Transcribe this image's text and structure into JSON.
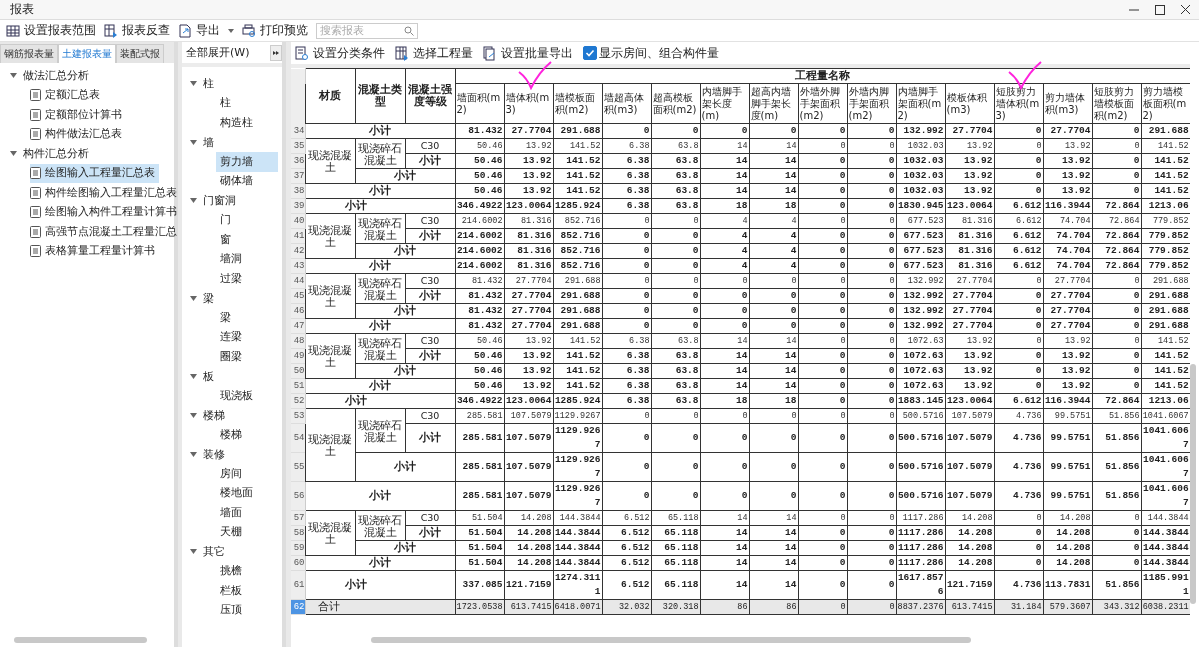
{
  "window": {
    "title": "报表"
  },
  "toolbar": [
    {
      "label": "设置报表范围",
      "kind": "range",
      "has_menu": false
    },
    {
      "label": "报表反查",
      "kind": "lookup",
      "has_menu": false
    },
    {
      "label": "导出",
      "kind": "export",
      "has_menu": true
    },
    {
      "label": "打印预览",
      "kind": "print",
      "has_menu": false
    }
  ],
  "search": {
    "placeholder": "搜索报表"
  },
  "report_tabs": [
    {
      "label": "钢筋报表量",
      "selected": false
    },
    {
      "label": "土建报表量",
      "selected": true
    },
    {
      "label": "装配式报",
      "selected": false
    }
  ],
  "report_tree": [
    {
      "label": "做法汇总分析",
      "expanded": true,
      "children": [
        {
          "label": "定额汇总表",
          "selected": false
        },
        {
          "label": "定额部位计算书",
          "selected": false
        },
        {
          "label": "构件做法汇总表",
          "selected": false
        }
      ]
    },
    {
      "label": "构件汇总分析",
      "expanded": true,
      "children": [
        {
          "label": "绘图输入工程量汇总表",
          "selected": true
        },
        {
          "label": "构件绘图输入工程量汇总表",
          "selected": false
        },
        {
          "label": "绘图输入构件工程量计算书",
          "selected": false
        },
        {
          "label": "高强节点混凝土工程量汇总",
          "selected": false
        },
        {
          "label": "表格算量工程量计算书",
          "selected": false
        }
      ]
    }
  ],
  "category_filter": {
    "value": "全部展开(W)"
  },
  "category_tree": [
    {
      "label": "柱",
      "expanded": true,
      "children": [
        {
          "label": "柱",
          "selected": false
        },
        {
          "label": "构造柱",
          "selected": false
        }
      ]
    },
    {
      "label": "墙",
      "expanded": true,
      "children": [
        {
          "label": "剪力墙",
          "selected": true
        },
        {
          "label": "砌体墙",
          "selected": false
        }
      ]
    },
    {
      "label": "门窗洞",
      "expanded": true,
      "children": [
        {
          "label": "门",
          "selected": false
        },
        {
          "label": "窗",
          "selected": false
        },
        {
          "label": "墙洞",
          "selected": false
        },
        {
          "label": "过梁",
          "selected": false
        }
      ]
    },
    {
      "label": "梁",
      "expanded": true,
      "children": [
        {
          "label": "梁",
          "selected": false
        },
        {
          "label": "连梁",
          "selected": false
        },
        {
          "label": "圈梁",
          "selected": false
        }
      ]
    },
    {
      "label": "板",
      "expanded": true,
      "children": [
        {
          "label": "现浇板",
          "selected": false
        }
      ]
    },
    {
      "label": "楼梯",
      "expanded": true,
      "children": [
        {
          "label": "楼梯",
          "selected": false
        }
      ]
    },
    {
      "label": "装修",
      "expanded": true,
      "children": [
        {
          "label": "房间",
          "selected": false
        },
        {
          "label": "楼地面",
          "selected": false
        },
        {
          "label": "墙面",
          "selected": false
        },
        {
          "label": "天棚",
          "selected": false
        }
      ]
    },
    {
      "label": "其它",
      "expanded": true,
      "children": [
        {
          "label": "挑檐",
          "selected": false
        },
        {
          "label": "栏板",
          "selected": false
        },
        {
          "label": "压顶",
          "selected": false
        }
      ]
    }
  ],
  "table_toolbar": {
    "buttons": [
      {
        "label": "设置分类条件",
        "kind": "classify"
      },
      {
        "label": "选择工程量",
        "kind": "select"
      },
      {
        "label": "设置批量导出",
        "kind": "batch"
      }
    ],
    "checkbox": {
      "label": "显示房间、组合构件量",
      "checked": true
    }
  },
  "table": {
    "fixed_columns": [
      "材质",
      "混凝土类型",
      "混凝土强度等级"
    ],
    "group_heading": "工程量名称",
    "columns": [
      {
        "label": "墙面积(m2)",
        "annotated": false
      },
      {
        "label": "墙体积(m3)",
        "annotated": true
      },
      {
        "label": "墙模板面积(m2)",
        "annotated": false
      },
      {
        "label": "墙超高体积(m3)",
        "annotated": false
      },
      {
        "label": "超高模板面积(m2)",
        "annotated": false
      },
      {
        "label": "内墙脚手架长度(m)",
        "annotated": false
      },
      {
        "label": "超高内墙脚手架长度(m)",
        "annotated": false
      },
      {
        "label": "外墙外脚手架面积(m2)",
        "annotated": false
      },
      {
        "label": "外墙内脚手架面积(m2)",
        "annotated": false
      },
      {
        "label": "内墙脚手架面积(m2)",
        "annotated": false
      },
      {
        "label": "模板体积(m3)",
        "annotated": false
      },
      {
        "label": "短肢剪力墙体积(m3)",
        "annotated": true
      },
      {
        "label": "剪力墙体积(m3)",
        "annotated": false
      },
      {
        "label": "短肢剪力墙模板面积(m2)",
        "annotated": false
      },
      {
        "label": "剪力墙模板面积(m2)",
        "annotated": false
      }
    ],
    "rows": [
      {
        "no": "34",
        "kind": "sub_material",
        "label": "小计",
        "selected": false,
        "values": [
          "81.432",
          "27.7704",
          "291.688",
          "0",
          "0",
          "0",
          "0",
          "0",
          "0",
          "132.992",
          "27.7704",
          "0",
          "27.7704",
          "0",
          "291.688"
        ]
      },
      {
        "no": "35",
        "kind": "detail",
        "material": "现浇混凝土",
        "type": "现浇碎石混凝土",
        "grade": "C30",
        "selected": false,
        "values": [
          "50.46",
          "13.92",
          "141.52",
          "6.38",
          "63.8",
          "14",
          "14",
          "0",
          "0",
          "1032.03",
          "13.92",
          "0",
          "13.92",
          "0",
          "141.52"
        ]
      },
      {
        "no": "36",
        "kind": "sub_grade",
        "label": "小计",
        "selected": false,
        "values": [
          "50.46",
          "13.92",
          "141.52",
          "6.38",
          "63.8",
          "14",
          "14",
          "0",
          "0",
          "1032.03",
          "13.92",
          "0",
          "13.92",
          "0",
          "141.52"
        ]
      },
      {
        "no": "37",
        "kind": "sub_type",
        "label": "小计",
        "selected": false,
        "values": [
          "50.46",
          "13.92",
          "141.52",
          "6.38",
          "63.8",
          "14",
          "14",
          "0",
          "0",
          "1032.03",
          "13.92",
          "0",
          "13.92",
          "0",
          "141.52"
        ]
      },
      {
        "no": "38",
        "kind": "sub_material",
        "label": "小计",
        "selected": false,
        "values": [
          "50.46",
          "13.92",
          "141.52",
          "6.38",
          "63.8",
          "14",
          "14",
          "0",
          "0",
          "1032.03",
          "13.92",
          "0",
          "13.92",
          "0",
          "141.52"
        ]
      },
      {
        "no": "39",
        "kind": "sub_total",
        "label": "小计",
        "selected": false,
        "values": [
          "346.4922",
          "123.0064",
          "1285.924",
          "6.38",
          "63.8",
          "18",
          "18",
          "0",
          "0",
          "1830.945",
          "123.0064",
          "6.612",
          "116.3944",
          "72.864",
          "1213.06"
        ]
      },
      {
        "no": "40",
        "kind": "detail",
        "material": "现浇混凝土",
        "type": "现浇碎石混凝土",
        "grade": "C30",
        "selected": false,
        "values": [
          "214.6002",
          "81.316",
          "852.716",
          "0",
          "0",
          "4",
          "4",
          "0",
          "0",
          "677.523",
          "81.316",
          "6.612",
          "74.704",
          "72.864",
          "779.852"
        ]
      },
      {
        "no": "41",
        "kind": "sub_grade",
        "label": "小计",
        "selected": false,
        "values": [
          "214.6002",
          "81.316",
          "852.716",
          "0",
          "0",
          "4",
          "4",
          "0",
          "0",
          "677.523",
          "81.316",
          "6.612",
          "74.704",
          "72.864",
          "779.852"
        ]
      },
      {
        "no": "42",
        "kind": "sub_type",
        "label": "小计",
        "selected": false,
        "values": [
          "214.6002",
          "81.316",
          "852.716",
          "0",
          "0",
          "4",
          "4",
          "0",
          "0",
          "677.523",
          "81.316",
          "6.612",
          "74.704",
          "72.864",
          "779.852"
        ]
      },
      {
        "no": "43",
        "kind": "sub_material",
        "label": "小计",
        "selected": false,
        "values": [
          "214.6002",
          "81.316",
          "852.716",
          "0",
          "0",
          "4",
          "4",
          "0",
          "0",
          "677.523",
          "81.316",
          "6.612",
          "74.704",
          "72.864",
          "779.852"
        ]
      },
      {
        "no": "44",
        "kind": "detail",
        "material": "现浇混凝土",
        "type": "现浇碎石混凝土",
        "grade": "C30",
        "selected": false,
        "values": [
          "81.432",
          "27.7704",
          "291.688",
          "0",
          "0",
          "0",
          "0",
          "0",
          "0",
          "132.992",
          "27.7704",
          "0",
          "27.7704",
          "0",
          "291.688"
        ]
      },
      {
        "no": "45",
        "kind": "sub_grade",
        "label": "小计",
        "selected": false,
        "values": [
          "81.432",
          "27.7704",
          "291.688",
          "0",
          "0",
          "0",
          "0",
          "0",
          "0",
          "132.992",
          "27.7704",
          "0",
          "27.7704",
          "0",
          "291.688"
        ]
      },
      {
        "no": "46",
        "kind": "sub_type",
        "label": "小计",
        "selected": false,
        "values": [
          "81.432",
          "27.7704",
          "291.688",
          "0",
          "0",
          "0",
          "0",
          "0",
          "0",
          "132.992",
          "27.7704",
          "0",
          "27.7704",
          "0",
          "291.688"
        ]
      },
      {
        "no": "47",
        "kind": "sub_material",
        "label": "小计",
        "selected": false,
        "values": [
          "81.432",
          "27.7704",
          "291.688",
          "0",
          "0",
          "0",
          "0",
          "0",
          "0",
          "132.992",
          "27.7704",
          "0",
          "27.7704",
          "0",
          "291.688"
        ]
      },
      {
        "no": "48",
        "kind": "detail",
        "material": "现浇混凝土",
        "type": "现浇碎石混凝土",
        "grade": "C30",
        "selected": false,
        "values": [
          "50.46",
          "13.92",
          "141.52",
          "6.38",
          "63.8",
          "14",
          "14",
          "0",
          "0",
          "1072.63",
          "13.92",
          "0",
          "13.92",
          "0",
          "141.52"
        ]
      },
      {
        "no": "49",
        "kind": "sub_grade",
        "label": "小计",
        "selected": false,
        "values": [
          "50.46",
          "13.92",
          "141.52",
          "6.38",
          "63.8",
          "14",
          "14",
          "0",
          "0",
          "1072.63",
          "13.92",
          "0",
          "13.92",
          "0",
          "141.52"
        ]
      },
      {
        "no": "50",
        "kind": "sub_type",
        "label": "小计",
        "selected": false,
        "values": [
          "50.46",
          "13.92",
          "141.52",
          "6.38",
          "63.8",
          "14",
          "14",
          "0",
          "0",
          "1072.63",
          "13.92",
          "0",
          "13.92",
          "0",
          "141.52"
        ]
      },
      {
        "no": "51",
        "kind": "sub_material",
        "label": "小计",
        "selected": false,
        "values": [
          "50.46",
          "13.92",
          "141.52",
          "6.38",
          "63.8",
          "14",
          "14",
          "0",
          "0",
          "1072.63",
          "13.92",
          "0",
          "13.92",
          "0",
          "141.52"
        ]
      },
      {
        "no": "52",
        "kind": "sub_total",
        "label": "小计",
        "selected": false,
        "values": [
          "346.4922",
          "123.0064",
          "1285.924",
          "6.38",
          "63.8",
          "18",
          "18",
          "0",
          "0",
          "1883.145",
          "123.0064",
          "6.612",
          "116.3944",
          "72.864",
          "1213.06"
        ]
      },
      {
        "no": "53",
        "kind": "detail",
        "material": "现浇混凝土",
        "type": "现浇碎石混凝土",
        "grade": "C30",
        "selected": false,
        "values": [
          "285.581",
          "107.5079",
          "1129.9267",
          "0",
          "0",
          "0",
          "0",
          "0",
          "0",
          "500.5716",
          "107.5079",
          "4.736",
          "99.5751",
          "51.856",
          "1041.6067"
        ]
      },
      {
        "no": "54",
        "kind": "sub_grade",
        "label": "小计",
        "selected": false,
        "values": [
          "285.581",
          "107.5079",
          "1129.9267",
          "0",
          "0",
          "0",
          "0",
          "0",
          "0",
          "500.5716",
          "107.5079",
          "4.736",
          "99.5751",
          "51.856",
          "1041.6067"
        ]
      },
      {
        "no": "55",
        "kind": "sub_type",
        "label": "小计",
        "selected": false,
        "values": [
          "285.581",
          "107.5079",
          "1129.9267",
          "0",
          "0",
          "0",
          "0",
          "0",
          "0",
          "500.5716",
          "107.5079",
          "4.736",
          "99.5751",
          "51.856",
          "1041.6067"
        ]
      },
      {
        "no": "56",
        "kind": "sub_material",
        "label": "小计",
        "selected": false,
        "values": [
          "285.581",
          "107.5079",
          "1129.9267",
          "0",
          "0",
          "0",
          "0",
          "0",
          "0",
          "500.5716",
          "107.5079",
          "4.736",
          "99.5751",
          "51.856",
          "1041.6067"
        ]
      },
      {
        "no": "57",
        "kind": "detail",
        "material": "现浇混凝土",
        "type": "现浇碎石混凝土",
        "grade": "C30",
        "selected": false,
        "values": [
          "51.504",
          "14.208",
          "144.3844",
          "6.512",
          "65.118",
          "14",
          "14",
          "0",
          "0",
          "1117.286",
          "14.208",
          "0",
          "14.208",
          "0",
          "144.3844"
        ]
      },
      {
        "no": "58",
        "kind": "sub_grade",
        "label": "小计",
        "selected": false,
        "values": [
          "51.504",
          "14.208",
          "144.3844",
          "6.512",
          "65.118",
          "14",
          "14",
          "0",
          "0",
          "1117.286",
          "14.208",
          "0",
          "14.208",
          "0",
          "144.3844"
        ]
      },
      {
        "no": "59",
        "kind": "sub_type",
        "label": "小计",
        "selected": false,
        "values": [
          "51.504",
          "14.208",
          "144.3844",
          "6.512",
          "65.118",
          "14",
          "14",
          "0",
          "0",
          "1117.286",
          "14.208",
          "0",
          "14.208",
          "0",
          "144.3844"
        ]
      },
      {
        "no": "60",
        "kind": "sub_material",
        "label": "小计",
        "selected": false,
        "values": [
          "51.504",
          "14.208",
          "144.3844",
          "6.512",
          "65.118",
          "14",
          "14",
          "0",
          "0",
          "1117.286",
          "14.208",
          "0",
          "14.208",
          "0",
          "144.3844"
        ]
      },
      {
        "no": "61",
        "kind": "sub_total",
        "label": "小计",
        "selected": false,
        "values": [
          "337.085",
          "121.7159",
          "1274.3111",
          "6.512",
          "65.118",
          "14",
          "14",
          "0",
          "0",
          "1617.8576",
          "121.7159",
          "4.736",
          "113.7831",
          "51.856",
          "1185.9911"
        ]
      },
      {
        "no": "62",
        "kind": "grand_total",
        "caption": "合计",
        "selected": true,
        "values": [
          "1723.0538",
          "613.7415",
          "6418.0071",
          "32.032",
          "320.318",
          "86",
          "86",
          "0",
          "0",
          "8837.2376",
          "613.7415",
          "31.184",
          "579.3607",
          "343.312",
          "6038.2311"
        ]
      }
    ]
  }
}
